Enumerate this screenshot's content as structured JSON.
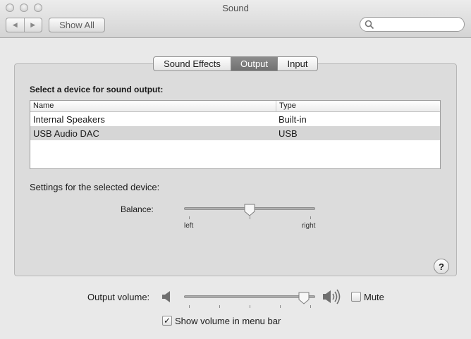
{
  "window": {
    "title": "Sound"
  },
  "toolbar": {
    "back_icon": "back-arrow-icon",
    "forward_icon": "forward-arrow-icon",
    "show_all_label": "Show All",
    "search_value": "",
    "search_icon": "search-icon"
  },
  "tabs": [
    {
      "label": "Sound Effects",
      "selected": false
    },
    {
      "label": "Output",
      "selected": true
    },
    {
      "label": "Input",
      "selected": false
    }
  ],
  "output": {
    "heading": "Select a device for sound output:",
    "columns": [
      "Name",
      "Type"
    ],
    "devices": [
      {
        "name": "Internal Speakers",
        "type": "Built-in",
        "selected": false
      },
      {
        "name": "USB Audio DAC",
        "type": "USB",
        "selected": true
      }
    ],
    "settings_label": "Settings for the selected device:",
    "balance": {
      "label": "Balance:",
      "left_label": "left",
      "right_label": "right",
      "value": 0.5
    }
  },
  "help_label": "?",
  "volume": {
    "label": "Output volume:",
    "value": 0.95,
    "low_icon": "speaker-low-icon",
    "high_icon": "speaker-high-icon",
    "mute_label": "Mute",
    "mute_checked": false
  },
  "menu_bar": {
    "label": "Show volume in menu bar",
    "checked": true
  }
}
